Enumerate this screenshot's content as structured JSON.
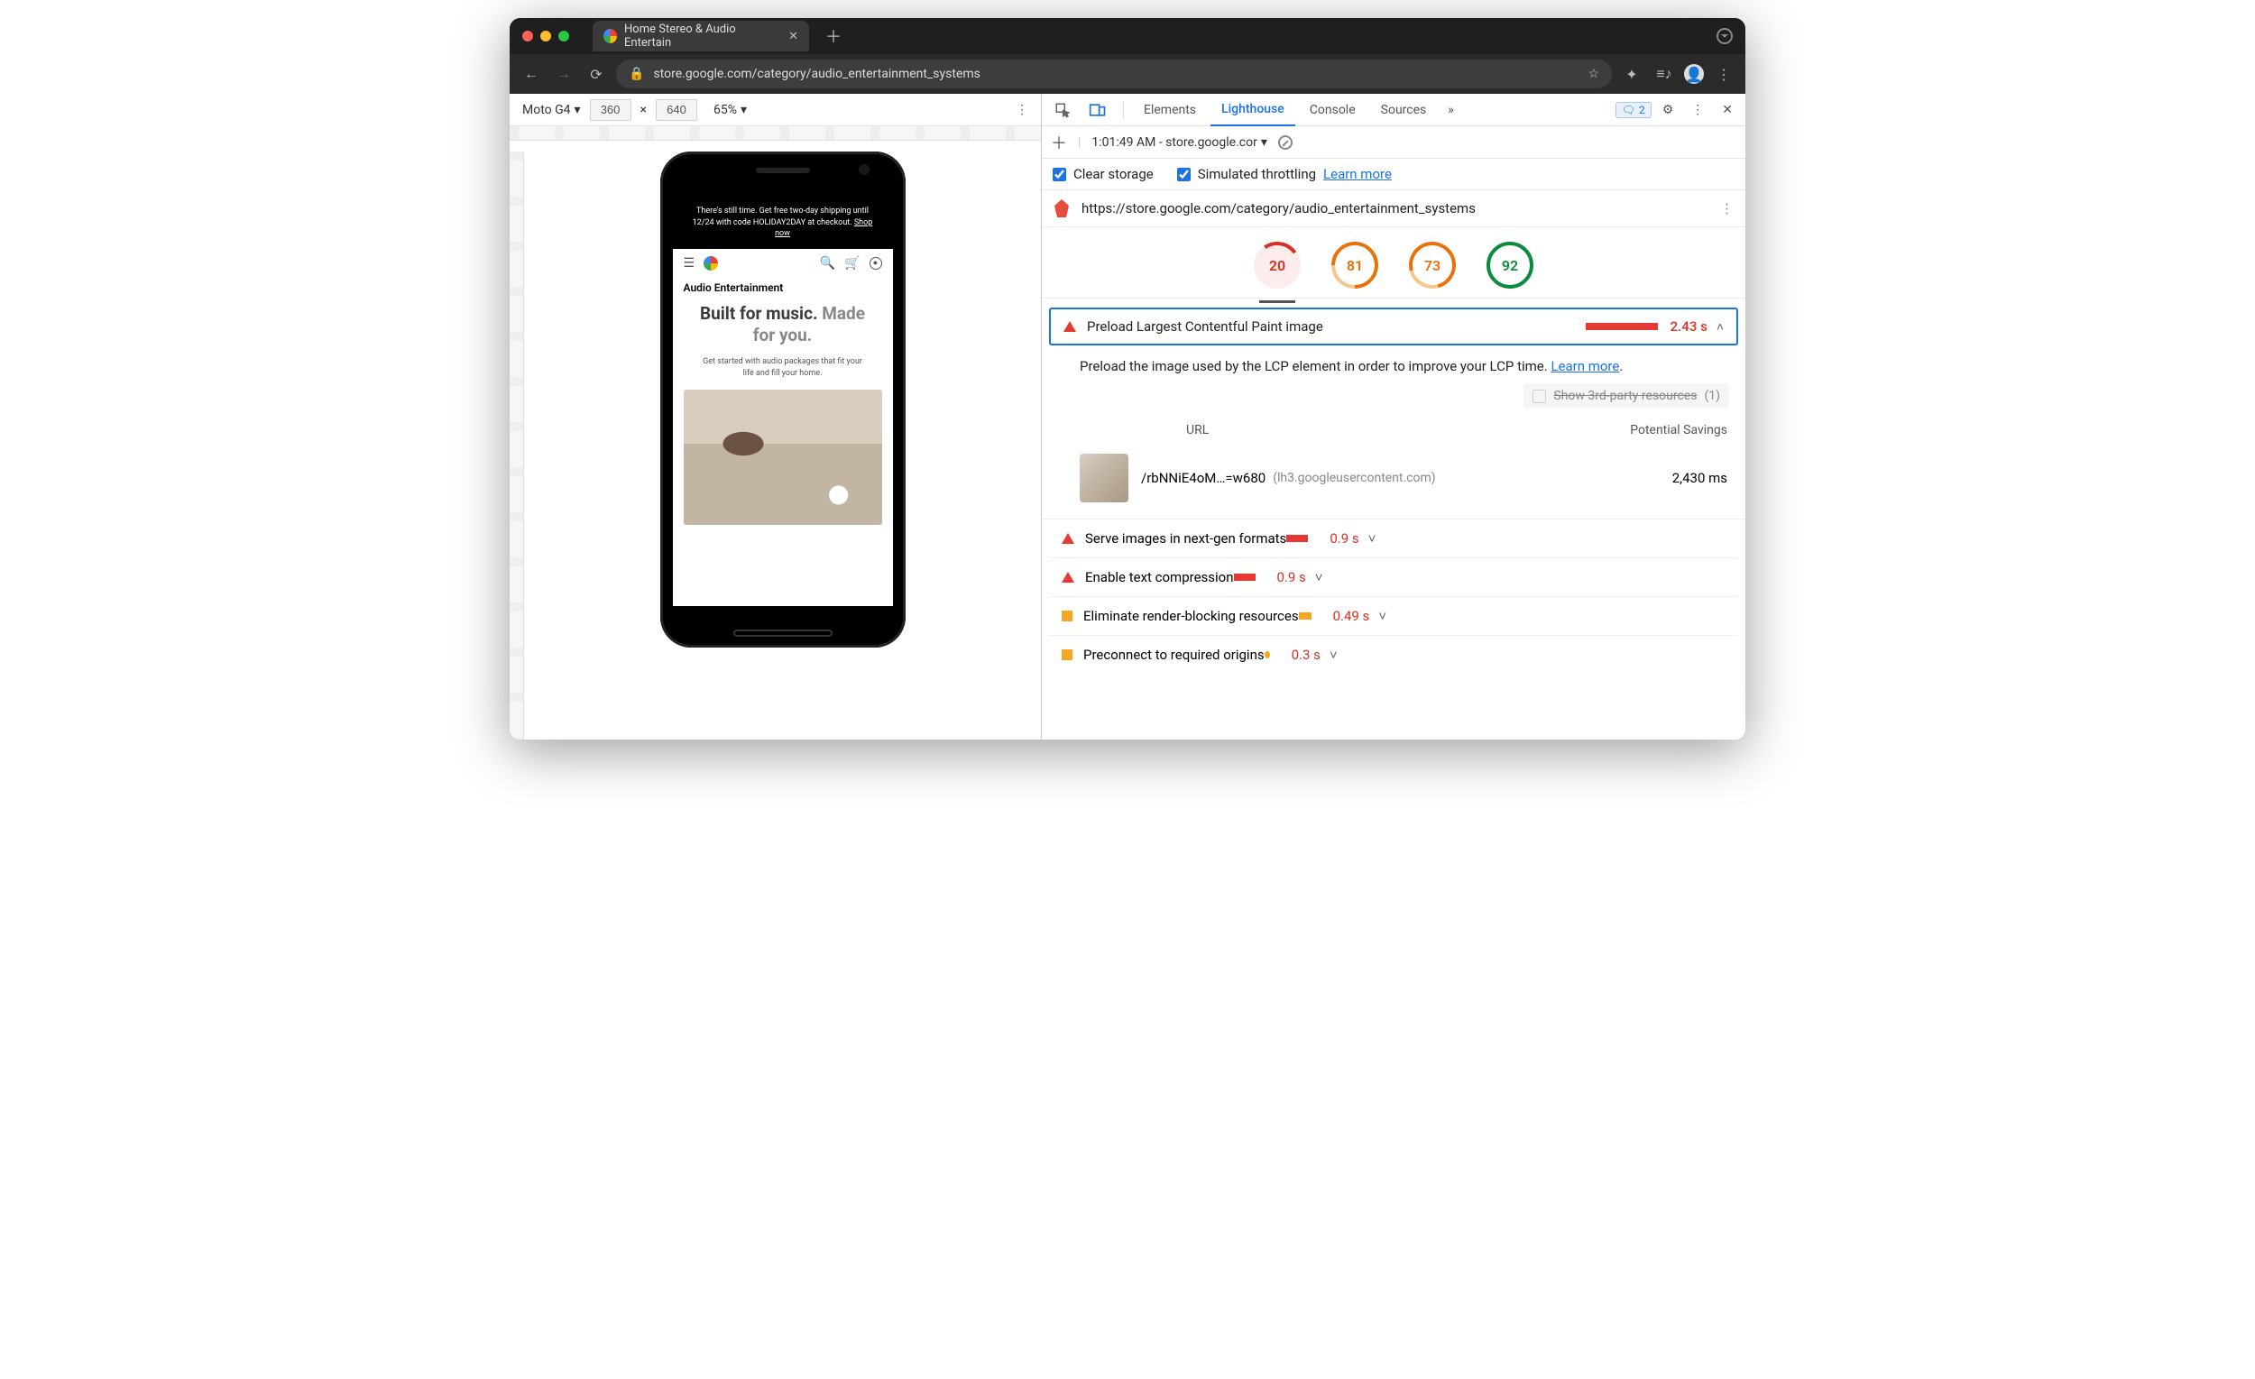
{
  "tab_title": "Home Stereo & Audio Entertain",
  "url": "store.google.com/category/audio_entertainment_systems",
  "device_toolbar": {
    "device": "Moto G4",
    "width": "360",
    "height": "640",
    "zoom": "65%"
  },
  "devtools": {
    "panels": [
      "Elements",
      "Lighthouse",
      "Console",
      "Sources"
    ],
    "active_panel": "Lighthouse",
    "message_count": "2",
    "report_time": "1:01:49 AM - store.google.cor",
    "clear_storage_label": "Clear storage",
    "sim_throttle_label": "Simulated throttling",
    "learn_more": "Learn more",
    "report_url": "https://store.google.com/category/audio_entertainment_systems",
    "scores": [
      "20",
      "81",
      "73",
      "92"
    ],
    "preload_audit": {
      "title": "Preload Largest Contentful Paint image",
      "value": "2.43 s",
      "description_pre": "Preload the image used by the LCP element in order to improve your LCP time. ",
      "description_link": "Learn more",
      "third_party_label": "Show 3rd-party resources",
      "third_party_count": "(1)",
      "col_url": "URL",
      "col_savings": "Potential Savings",
      "row_path": "/rbNNiE4oM…=w680",
      "row_host": "(lh3.googleusercontent.com)",
      "row_savings": "2,430 ms"
    },
    "other_audits": [
      {
        "icon": "tri",
        "title": "Serve images in next-gen formats",
        "bar": "sm",
        "value": "0.9 s"
      },
      {
        "icon": "tri",
        "title": "Enable text compression",
        "bar": "sm",
        "value": "0.9 s"
      },
      {
        "icon": "sq",
        "title": "Eliminate render-blocking resources",
        "bar": "tiny",
        "value": "0.49 s"
      },
      {
        "icon": "sq",
        "title": "Preconnect to required origins",
        "bar": "dot",
        "value": "0.3 s"
      }
    ]
  },
  "page_preview": {
    "banner_pre": "There's still time. Get free two-day shipping until 12/24 with code HOLIDAY2DAY at checkout. ",
    "banner_link": "Shop now",
    "title": "Audio Entertainment",
    "hero1a": "Built for music.",
    "hero1b": " Made for you.",
    "sub": "Get started with audio packages that fit your life and fill your home."
  }
}
